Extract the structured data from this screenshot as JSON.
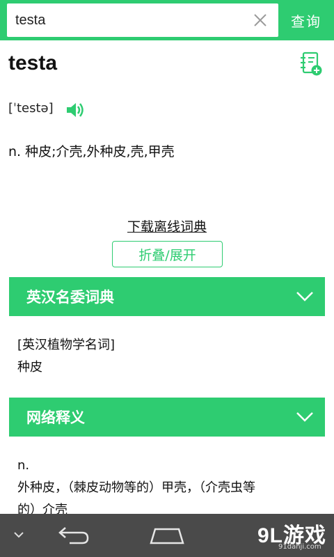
{
  "search": {
    "value": "testa",
    "query_label": "查询"
  },
  "word": {
    "headword": "testa",
    "phonetic": "[ˈtestə]",
    "definition": "n. 种皮;介壳,外种皮,壳,甲壳"
  },
  "actions": {
    "download_label": "下载离线词典",
    "fold_label": "折叠/展开"
  },
  "sections": [
    {
      "title": "英汉名委词典",
      "lines": [
        "[英汉植物学名词]",
        "种皮"
      ]
    },
    {
      "title": "网络释义",
      "lines": [
        "n.",
        "外种皮，（棘皮动物等的）甲壳，（介壳虫等",
        "的）介壳"
      ]
    }
  ],
  "watermark": {
    "main": "9L游戏",
    "sub": "91danji.com"
  },
  "colors": {
    "accent": "#2ecc71",
    "navbar": "#4a4a4a"
  },
  "icons": {
    "clear": "close-icon",
    "wordbook": "wordbook-add-icon",
    "speaker": "speaker-icon",
    "section_toggle": "chevron-down-icon",
    "nav_back": "back-icon",
    "nav_home": "home-icon"
  }
}
